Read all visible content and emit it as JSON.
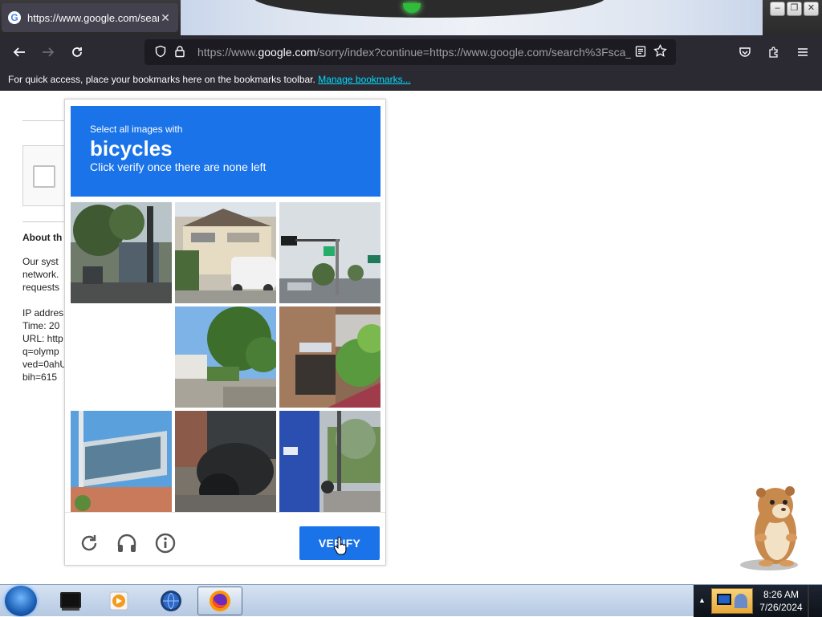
{
  "browser": {
    "tab_title": "https://www.google.com/search",
    "tab_close": "✕",
    "url_host_prefix": "https://www.",
    "url_host": "google.com",
    "url_rest": "/sorry/index?continue=https://www.google.com/search%3Fsca_e",
    "bookmarks_text": "For quick access, place your bookmarks here on the bookmarks toolbar.",
    "bookmarks_link": "Manage bookmarks..."
  },
  "page": {
    "about_heading": "About th",
    "about_lines": [
      "Our syst",
      "network.",
      "requests"
    ],
    "ip_label": "IP addres",
    "time_label": "Time: 20",
    "url_label": "URL: http",
    "q_label": "q=olymp",
    "ved_label": "ved=0ahU",
    "bih_label": "bih=615"
  },
  "captcha": {
    "instruction": "Select all images with",
    "target": "bicycles",
    "subtext": "Click verify once there are none left",
    "verify_label": "VERIFY",
    "icons": [
      "reload-icon",
      "headphones-icon",
      "info-icon"
    ]
  },
  "taskbar": {
    "time": "8:26 AM",
    "date": "7/26/2024"
  }
}
